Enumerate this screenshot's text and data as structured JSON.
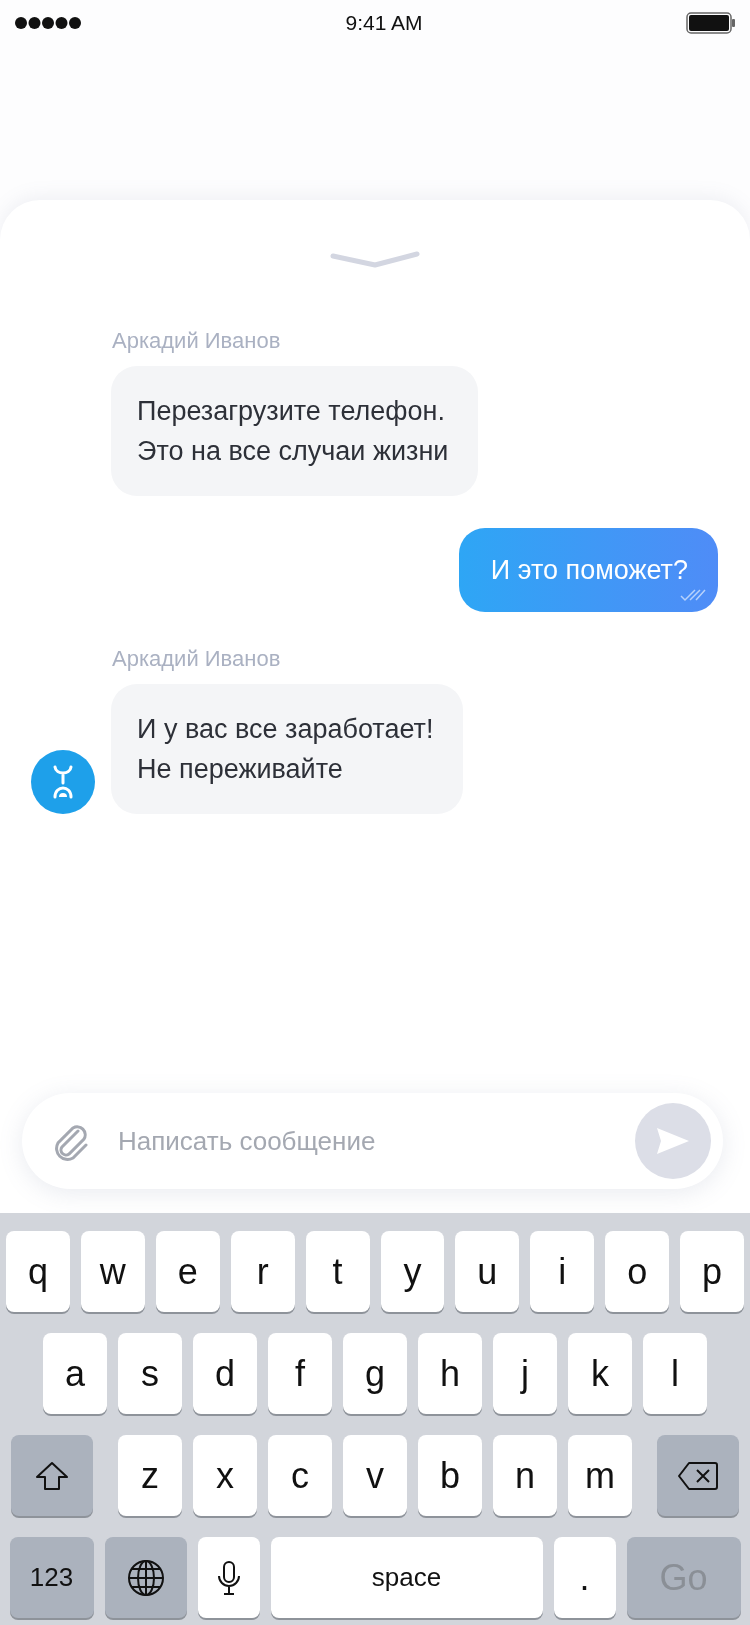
{
  "status_bar": {
    "time": "9:41 AM"
  },
  "messages": [
    {
      "kind": "incoming",
      "sender": "Аркадий Иванов",
      "lines": [
        "Перезагрузите телефон.",
        "Это на все случаи жизни"
      ],
      "avatar": false
    },
    {
      "kind": "outgoing",
      "lines": [
        "И это поможет?"
      ],
      "read": true
    },
    {
      "kind": "incoming",
      "sender": "Аркадий Иванов",
      "lines": [
        "И у вас все заработает!",
        "Не переживайте"
      ],
      "avatar": true
    }
  ],
  "composer": {
    "placeholder": "Написать сообщение"
  },
  "keyboard": {
    "rows": [
      {
        "keys": [
          {
            "kind": "letter",
            "label": "q"
          },
          {
            "kind": "letter",
            "label": "w"
          },
          {
            "kind": "letter",
            "label": "e"
          },
          {
            "kind": "letter",
            "label": "r"
          },
          {
            "kind": "letter",
            "label": "t"
          },
          {
            "kind": "letter",
            "label": "y"
          },
          {
            "kind": "letter",
            "label": "u"
          },
          {
            "kind": "letter",
            "label": "i"
          },
          {
            "kind": "letter",
            "label": "o"
          },
          {
            "kind": "letter",
            "label": "p"
          }
        ]
      },
      {
        "keys": [
          {
            "kind": "letter",
            "label": "a"
          },
          {
            "kind": "letter",
            "label": "s"
          },
          {
            "kind": "letter",
            "label": "d"
          },
          {
            "kind": "letter",
            "label": "f"
          },
          {
            "kind": "letter",
            "label": "g"
          },
          {
            "kind": "letter",
            "label": "h"
          },
          {
            "kind": "letter",
            "label": "j"
          },
          {
            "kind": "letter",
            "label": "k"
          },
          {
            "kind": "letter",
            "label": "l"
          }
        ]
      },
      {
        "keys": [
          {
            "kind": "shift"
          },
          {
            "kind": "letter",
            "label": "z"
          },
          {
            "kind": "letter",
            "label": "x"
          },
          {
            "kind": "letter",
            "label": "c"
          },
          {
            "kind": "letter",
            "label": "v"
          },
          {
            "kind": "letter",
            "label": "b"
          },
          {
            "kind": "letter",
            "label": "n"
          },
          {
            "kind": "letter",
            "label": "m"
          },
          {
            "kind": "backspace"
          }
        ]
      },
      {
        "keys": [
          {
            "kind": "numbers",
            "label": "123"
          },
          {
            "kind": "globe"
          },
          {
            "kind": "mic"
          },
          {
            "kind": "space",
            "label": "space"
          },
          {
            "kind": "period",
            "label": "."
          },
          {
            "kind": "go",
            "label": "Go"
          }
        ]
      }
    ]
  }
}
